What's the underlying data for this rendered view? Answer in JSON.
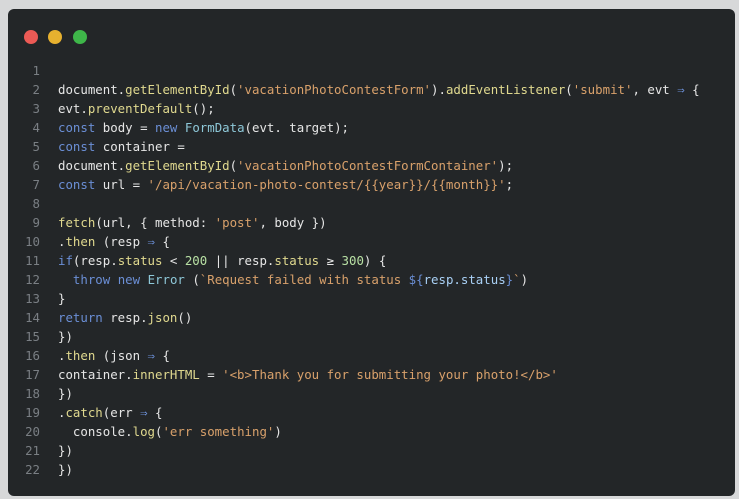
{
  "window": {
    "traffic_lights": [
      "close",
      "minimize",
      "zoom"
    ],
    "colors": {
      "close": "#ec5a55",
      "minimize": "#e7b12f",
      "zoom": "#3eb649",
      "background": "#232628"
    }
  },
  "code": {
    "line_numbers": [
      "1",
      "2",
      "3",
      "4",
      "5",
      "6",
      "7",
      "8",
      "9",
      "10",
      "11",
      "12",
      "13",
      "14",
      "15",
      "16",
      "17",
      "18",
      "19",
      "20",
      "21",
      "22"
    ],
    "lines": [
      "",
      "document.getElementById('vacationPhotoContestForm').addEventListener('submit', evt => {",
      "evt.preventDefault();",
      "const body = new FormData(evt. target);",
      "const container =",
      "document.getElementById('vacationPhotoContestFormContainer');",
      "const url = '/api/vacation-photo-contest/{{year}}/{{month}}';",
      "",
      "fetch(url, { method: 'post', body })",
      ".then (resp => {",
      "if(resp.status < 200 || resp.status >= 300) {",
      "  throw new Error (`Request failed with status ${resp.status}`)",
      "}",
      "return resp.json()",
      "})",
      ".then (json => {",
      "container.innerHTML = '<b>Thank you for submitting your photo!</b>'",
      "})",
      ".catch(err => {",
      "  console.log('err something')",
      "})",
      "})"
    ]
  }
}
